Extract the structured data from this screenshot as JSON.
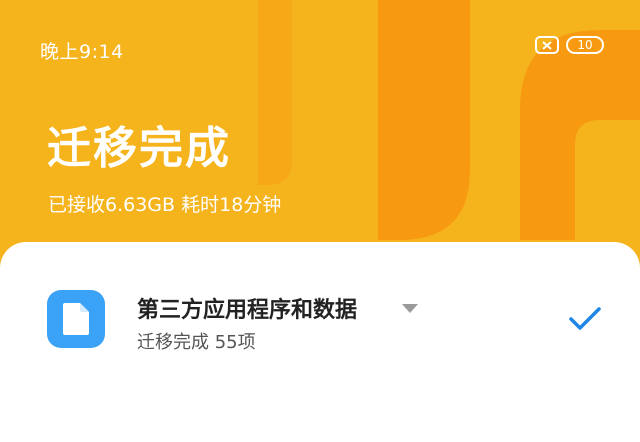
{
  "status_bar": {
    "time": "晚上9:14",
    "battery_level": "10",
    "notification_icon": "close-box-icon"
  },
  "hero": {
    "title": "迁移完成",
    "subtitle": "已接收6.63GB 耗时18分钟"
  },
  "item": {
    "title": "第三方应用程序和数据",
    "status": "迁移完成 55项",
    "icon": "document-icon",
    "checked": true
  },
  "colors": {
    "background": "#f5b31c",
    "accent_shapes": "#f79a12",
    "icon_bg": "#3aa2f7",
    "check": "#1e86e6"
  }
}
